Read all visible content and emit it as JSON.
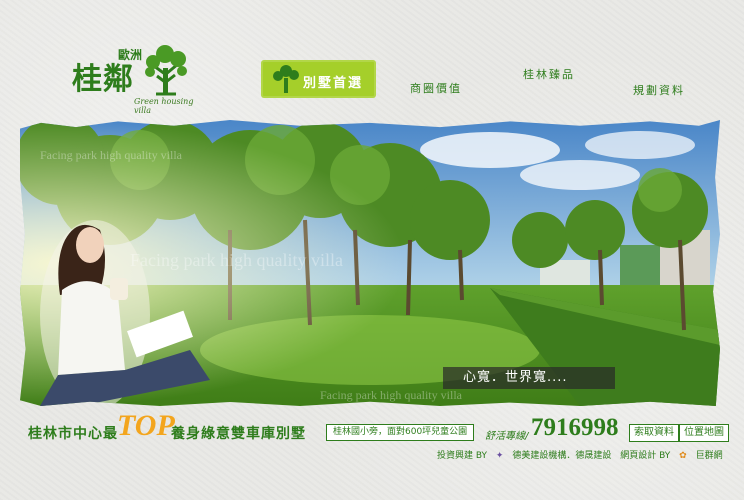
{
  "logo": {
    "small": "歐洲",
    "big": "桂鄰",
    "tagline": "Green housing villa"
  },
  "nav": {
    "active": "別墅首選",
    "items": [
      "商圈價值",
      "桂林臻品",
      "規劃資料"
    ]
  },
  "hero": {
    "watermark_top": "Facing park high quality villa",
    "watermark_mid": "Facing park high quality villa",
    "watermark_bottom": "Facing park high quality villa",
    "caption": "心寬．世界寬...."
  },
  "footer": {
    "slogan_left": "桂林市中心最",
    "slogan_top": "TOP",
    "slogan_right": "養身綠意雙車庫別墅",
    "badge": "桂林國小旁，面對600坪兒童公園",
    "phone_label": "舒活專線/",
    "phone": "7916998",
    "btn_request": "索取資料",
    "btn_map": "位置地圖",
    "credits": {
      "invest_label": "投資興建 BY",
      "invest_value": "德美建設機構．德晟建設",
      "design_label": "網頁設計 BY",
      "design_value": "巨群網"
    }
  },
  "colors": {
    "brand_green": "#2e7d1c",
    "nav_active_bg": "#a5cf2a",
    "accent_orange": "#f3a51d"
  }
}
